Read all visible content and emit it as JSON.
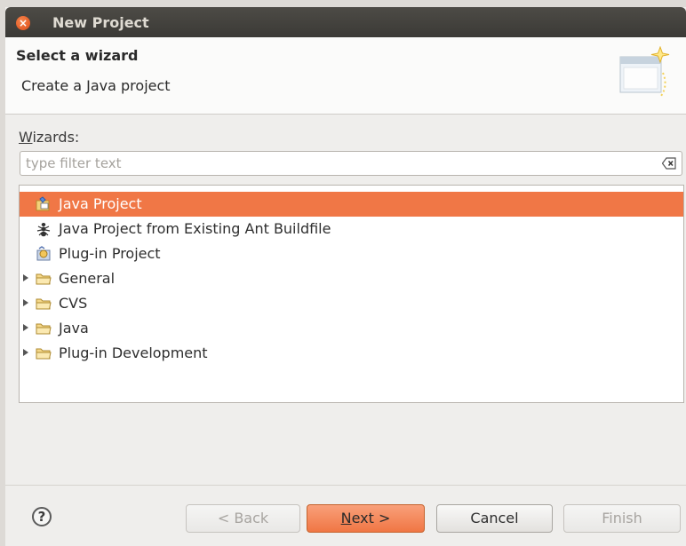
{
  "window": {
    "title": "New Project"
  },
  "header": {
    "title": "Select a wizard",
    "description": "Create a Java project"
  },
  "wizards": {
    "label_mnemonic": "W",
    "label_rest": "izards:",
    "filter_placeholder": "type filter text",
    "filter_value": "",
    "items": [
      {
        "label": "Java Project",
        "icon": "java-project-icon",
        "selected": true,
        "expandable": false
      },
      {
        "label": "Java Project from Existing Ant Buildfile",
        "icon": "ant-icon",
        "selected": false,
        "expandable": false
      },
      {
        "label": "Plug-in Project",
        "icon": "plugin-project-icon",
        "selected": false,
        "expandable": false
      },
      {
        "label": "General",
        "icon": "folder-icon",
        "selected": false,
        "expandable": true
      },
      {
        "label": "CVS",
        "icon": "folder-icon",
        "selected": false,
        "expandable": true
      },
      {
        "label": "Java",
        "icon": "folder-icon",
        "selected": false,
        "expandable": true
      },
      {
        "label": "Plug-in Development",
        "icon": "folder-icon",
        "selected": false,
        "expandable": true
      }
    ]
  },
  "buttons": {
    "help": "?",
    "back": "< Back",
    "next_mnemonic": "N",
    "next_rest": "ext >",
    "cancel": "Cancel",
    "finish": "Finish"
  },
  "colors": {
    "accent": "#f07746",
    "titlebar": "#3c3b37"
  }
}
